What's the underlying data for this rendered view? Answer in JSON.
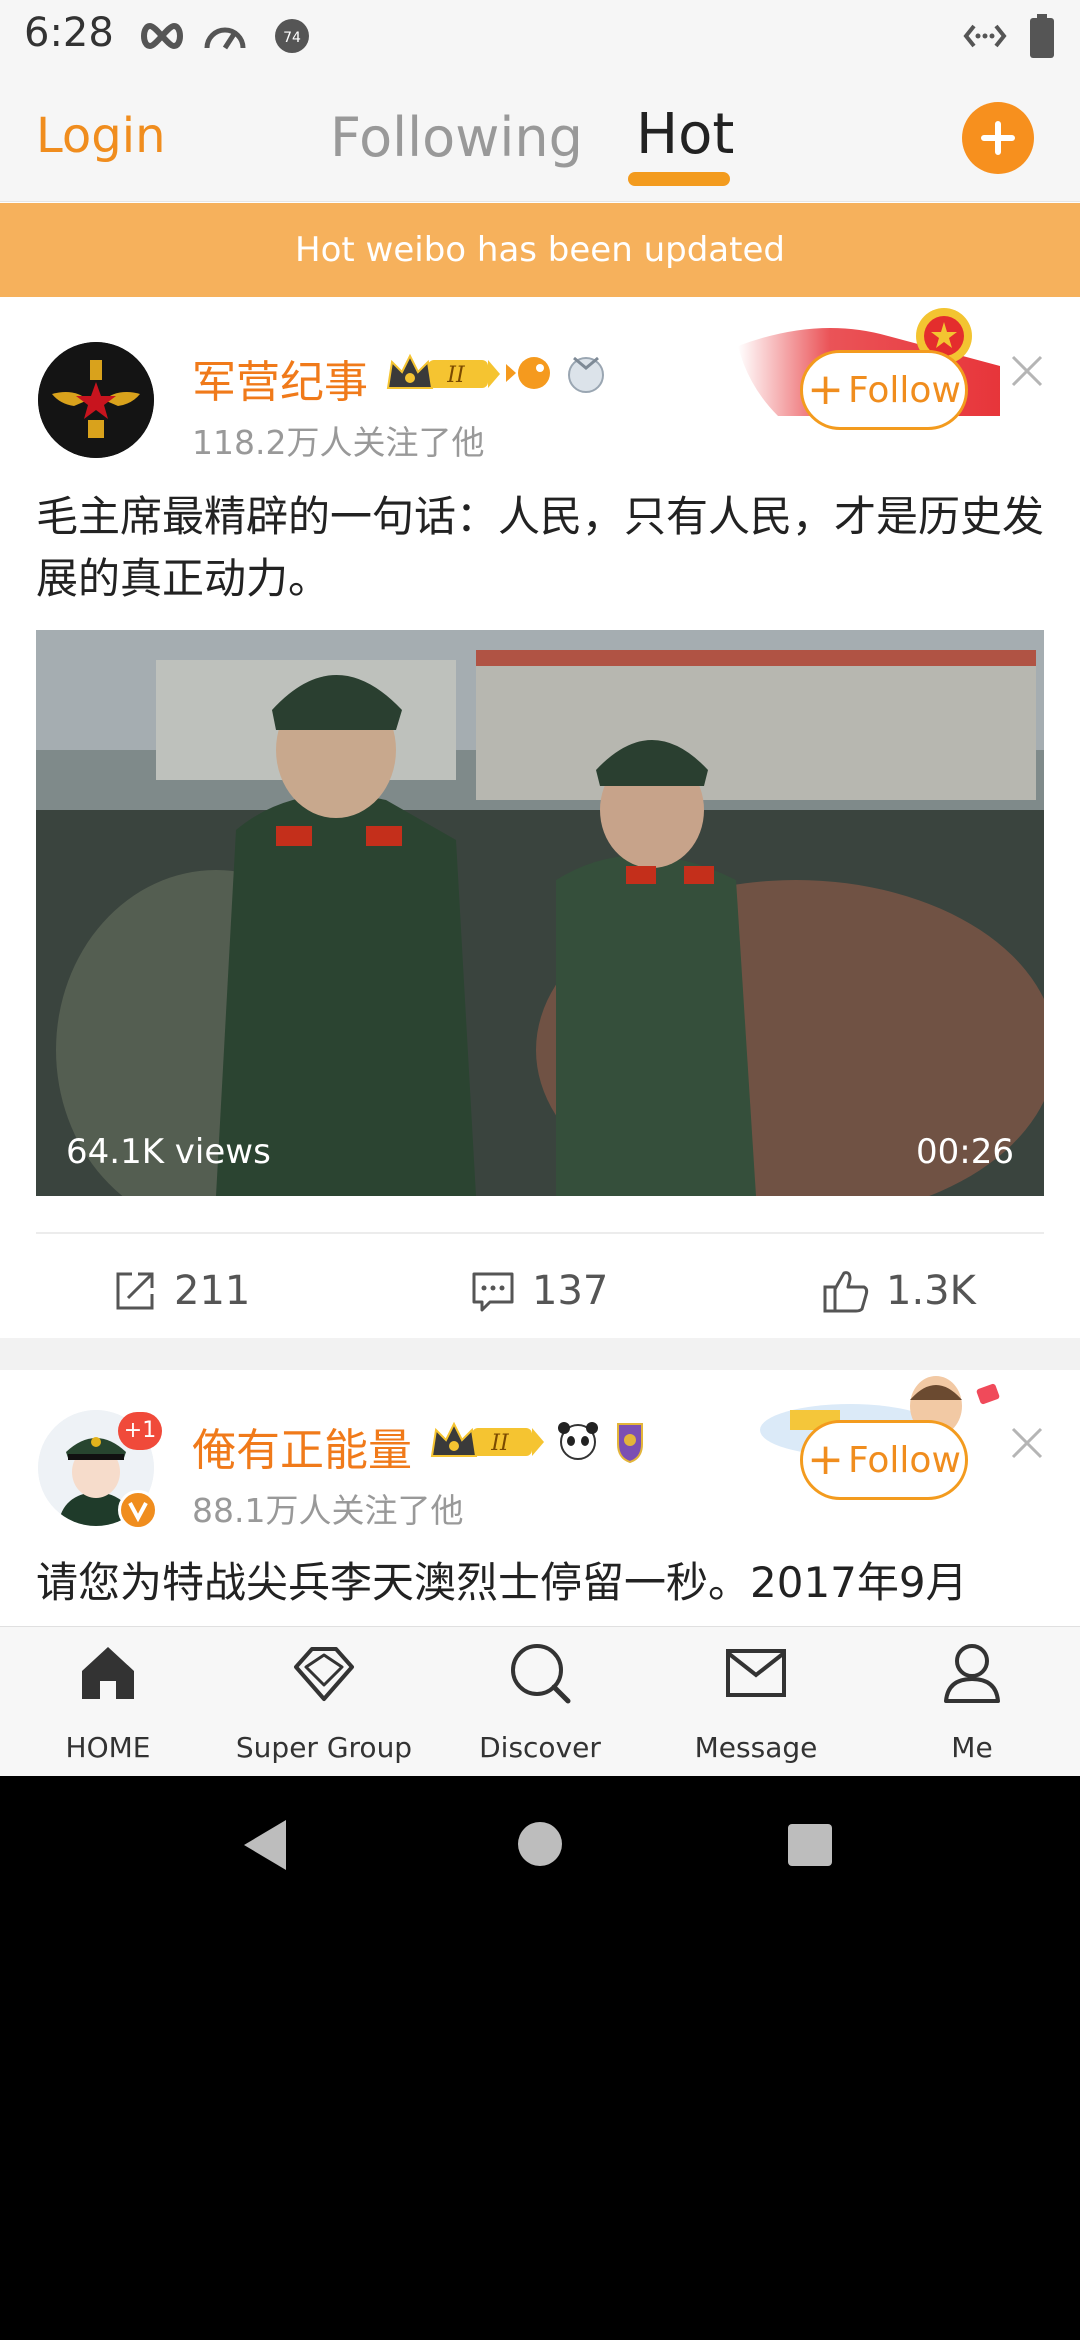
{
  "status_bar": {
    "time": "6:28",
    "icons": [
      "infinity-icon",
      "speedometer-icon",
      "notification-badge-icon",
      "data-arrows-icon",
      "battery-icon"
    ],
    "notification_count": "74"
  },
  "top_nav": {
    "login_label": "Login",
    "tabs": [
      {
        "label": "Following",
        "active": false
      },
      {
        "label": "Hot",
        "active": true
      }
    ],
    "accent_color": "#f7901e"
  },
  "banner": {
    "text": "Hot weibo has been updated",
    "color": "#f6b15c"
  },
  "posts": [
    {
      "username": "军营纪事",
      "followers": "118.2万人关注了他",
      "badge_level": "II",
      "follow_label": "Follow",
      "text": "毛主席最精辟的一句话：人民，只有人民，才是历史发展的真正动力。",
      "video": {
        "views": "64.1K views",
        "duration": "00:26"
      },
      "actions": {
        "repost": "211",
        "comment": "137",
        "like": "1.3K"
      }
    },
    {
      "username": "俺有正能量",
      "followers": "88.1万人关注了他",
      "badge_level": "II",
      "avatar_badge": "+1",
      "follow_label": "Follow",
      "text": "请您为特战尖兵李天澳烈士停留一秒。2017年9月"
    }
  ],
  "tab_bar": {
    "items": [
      {
        "label": "HOME",
        "icon": "home-icon"
      },
      {
        "label": "Super Group",
        "icon": "diamond-icon"
      },
      {
        "label": "Discover",
        "icon": "search-icon"
      },
      {
        "label": "Message",
        "icon": "mail-icon"
      },
      {
        "label": "Me",
        "icon": "person-icon"
      }
    ]
  }
}
